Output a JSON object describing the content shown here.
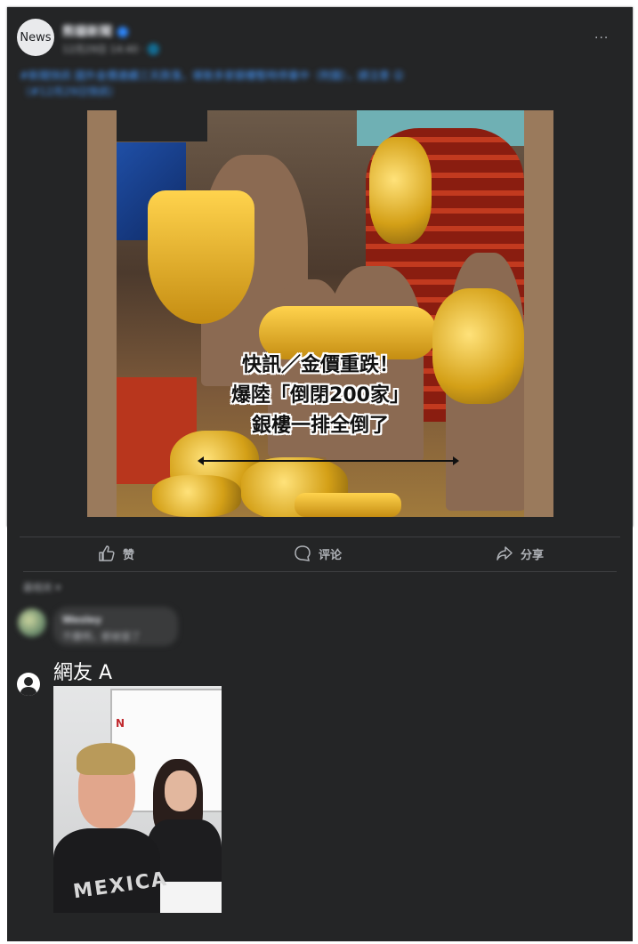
{
  "post": {
    "avatar_label": "News",
    "poster_name": "熊貓新聞",
    "meta": "12月29日 14:40 · 🌐",
    "more_icon": "···",
    "text": "#新聞快訊 國外金價連續三天跌落，導致多家銀樓暫時停業中（附圖），請注意 😮",
    "link": "（#12月29日快訊）"
  },
  "photo": {
    "headline_lines": [
      "快訊／金價重跌！",
      "爆陸「倒閉200家」",
      "銀樓一排全倒了"
    ]
  },
  "actions": {
    "like_label": "赞",
    "comment_label": "评论",
    "share_label": "分享"
  },
  "comments": {
    "sort_label": "最相关 ▾",
    "first_name": "Wesley",
    "first_text": "不攤啊，都被當了",
    "second_commenter": "網友 A",
    "meme_board_letter": "N",
    "meme_hoodie_text": "MEXICA"
  },
  "colors": {
    "panel": "#242526",
    "text": "#e4e6eb",
    "muted": "#b0b3b8",
    "link": "#4599ff"
  }
}
